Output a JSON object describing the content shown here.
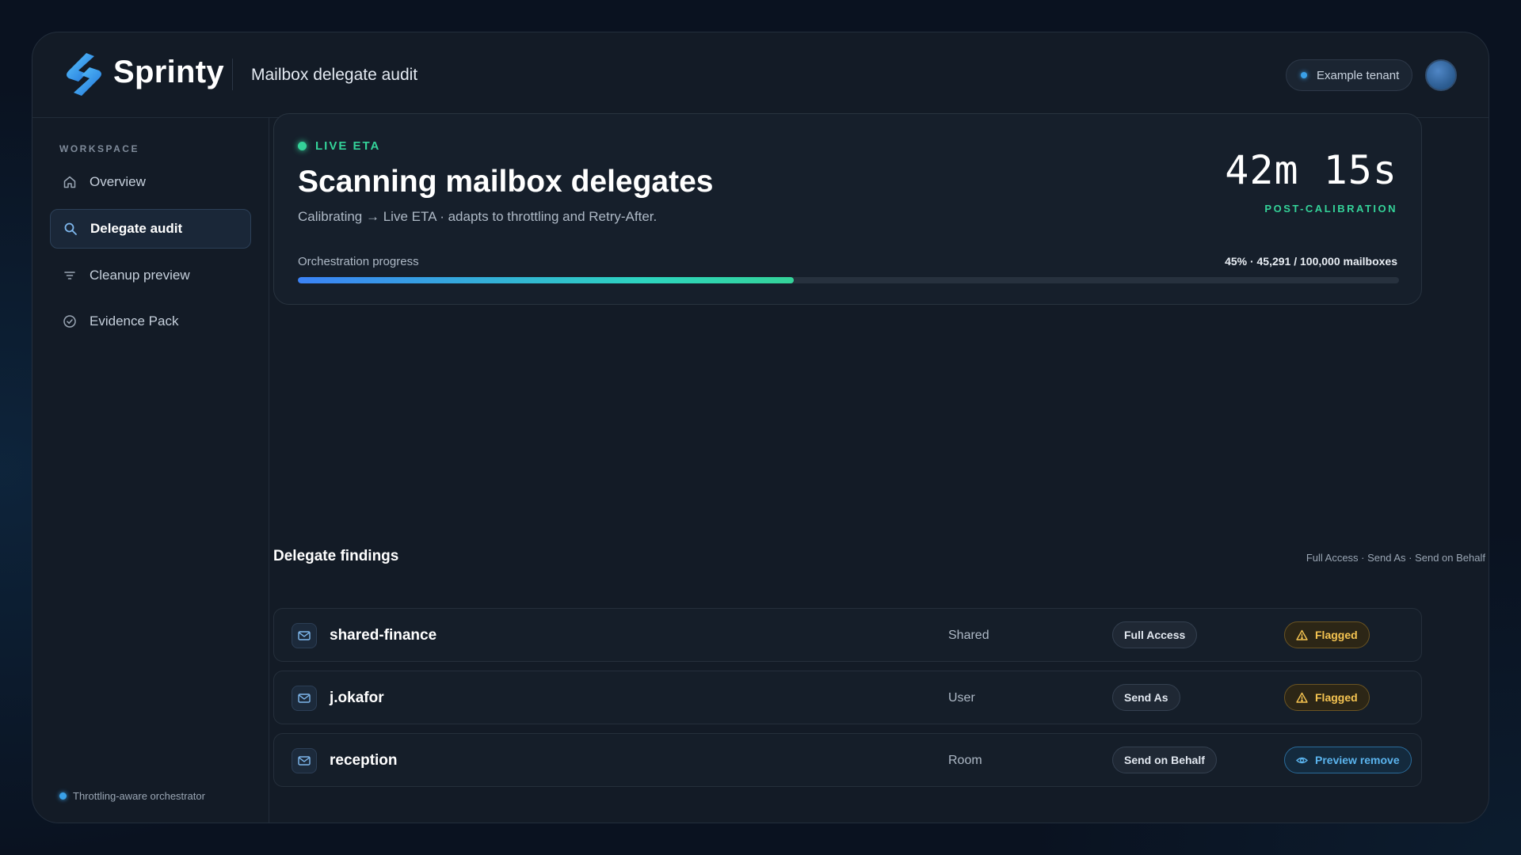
{
  "header": {
    "brand": "Sprinty",
    "page_title": "Mailbox delegate audit",
    "tenant": "Example tenant"
  },
  "sidebar": {
    "section_label": "WORKSPACE",
    "items": [
      {
        "label": "Overview",
        "icon": "home-icon"
      },
      {
        "label": "Delegate audit",
        "icon": "search-icon",
        "active": true
      },
      {
        "label": "Cleanup preview",
        "icon": "filter-icon"
      },
      {
        "label": "Evidence Pack",
        "icon": "check-circle-icon"
      }
    ],
    "footer": "Throttling-aware orchestrator"
  },
  "eta": {
    "badge": "LIVE ETA",
    "title": "Scanning mailbox delegates",
    "subtitle": "Calibrating → Live ETA · adapts to throttling and Retry-After.",
    "time": "42m 15s",
    "time_label": "POST-CALIBRATION",
    "progress_label": "Orchestration progress",
    "progress_stats": "45% · 45,291 / 100,000 mailboxes",
    "progress_fraction": 0.45
  },
  "findings": {
    "title": "Delegate findings",
    "legend": "Full Access · Send As · Send on Behalf",
    "rows": [
      {
        "name": "shared-finance",
        "type": "Shared",
        "permission": "Full Access",
        "status": "Flagged",
        "status_kind": "flag"
      },
      {
        "name": "j.okafor",
        "type": "User",
        "permission": "Send As",
        "status": "Flagged",
        "status_kind": "flag"
      },
      {
        "name": "reception",
        "type": "Room",
        "permission": "Send on Behalf",
        "status": "Preview remove",
        "status_kind": "preview"
      }
    ]
  },
  "colors": {
    "accent_green": "#34d399",
    "accent_blue": "#3aa1e8",
    "flag_amber": "#f5c451"
  }
}
